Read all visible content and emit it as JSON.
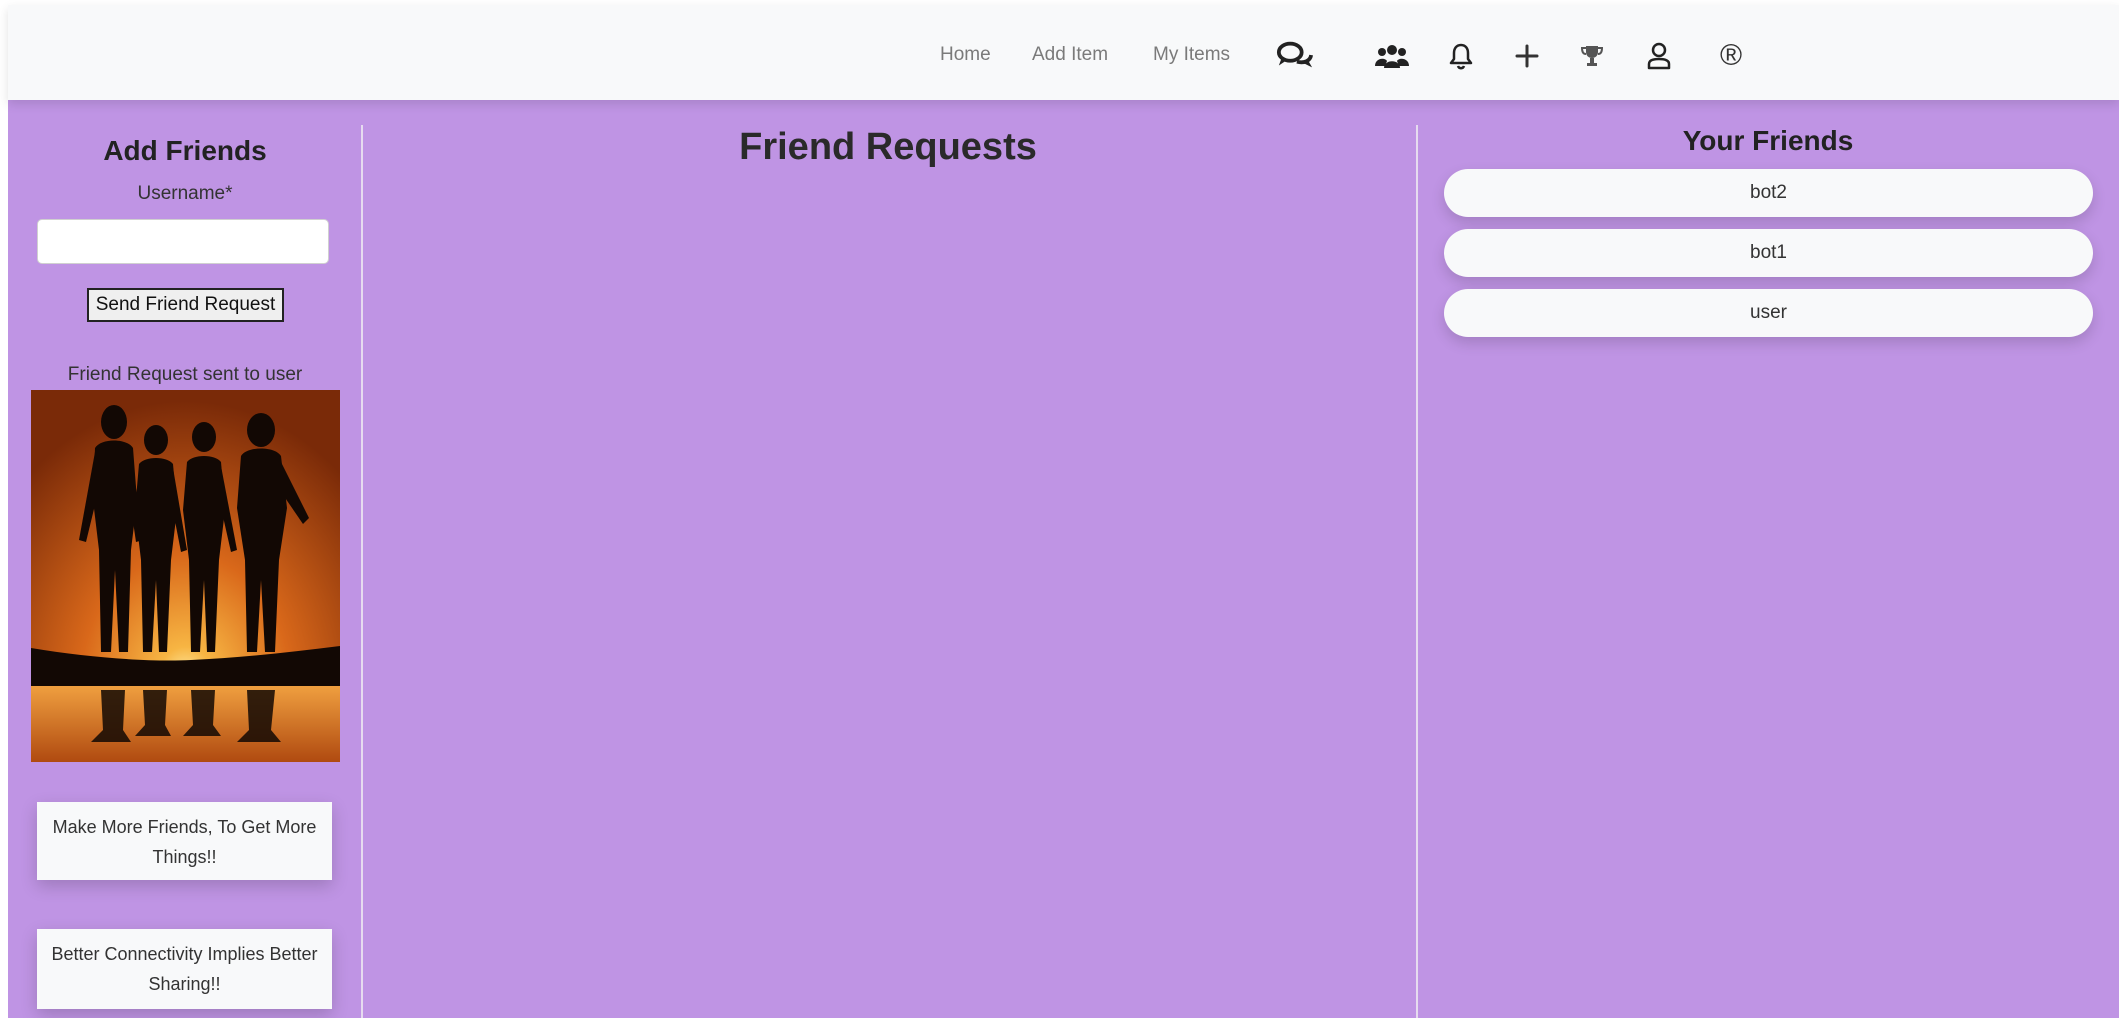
{
  "navbar": {
    "links": [
      {
        "label": "Home"
      },
      {
        "label": "Add Item"
      },
      {
        "label": "My Items"
      }
    ],
    "icons": [
      {
        "name": "chat-icon"
      },
      {
        "name": "friends-icon"
      },
      {
        "name": "bell-icon"
      },
      {
        "name": "plus-icon"
      },
      {
        "name": "trophy-icon"
      },
      {
        "name": "user-icon"
      },
      {
        "name": "registered-icon",
        "glyph": "®"
      }
    ]
  },
  "add_friends": {
    "title": "Add Friends",
    "username_label": "Username*",
    "username_value": "",
    "send_button": "Send Friend Request",
    "status_message": "Friend Request sent to user",
    "cards": [
      {
        "text": "Make More Friends, To Get More Things!!"
      },
      {
        "text": "Better Connectivity Implies Better Sharing!!"
      }
    ]
  },
  "friend_requests": {
    "title": "Friend Requests"
  },
  "your_friends": {
    "title": "Your Friends",
    "items": [
      {
        "name": "bot2"
      },
      {
        "name": "bot1"
      },
      {
        "name": "user"
      }
    ]
  },
  "colors": {
    "background": "#bf94e4",
    "navbar": "#f8f9fa",
    "card": "#f8f9fa"
  }
}
